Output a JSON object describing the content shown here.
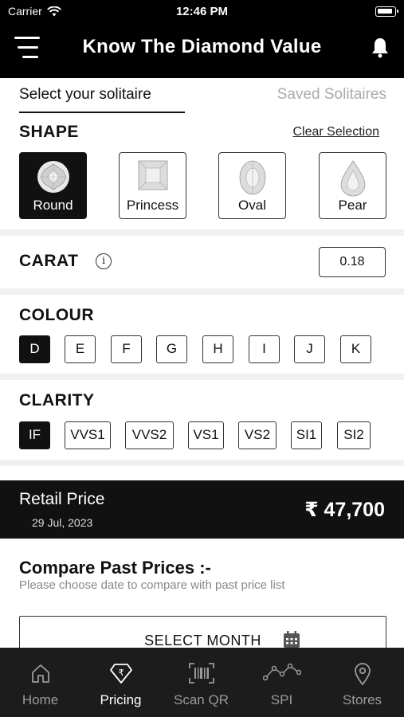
{
  "status_bar": {
    "carrier": "Carrier",
    "time": "12:46 PM"
  },
  "header": {
    "title": "Know The Diamond Value"
  },
  "tabs": [
    {
      "label": "Select your solitaire",
      "active": true
    },
    {
      "label": "Saved Solitaires",
      "active": false
    }
  ],
  "shape": {
    "title": "SHAPE",
    "clear_label": "Clear Selection",
    "options": [
      {
        "label": "Round",
        "selected": true
      },
      {
        "label": "Princess",
        "selected": false
      },
      {
        "label": "Oval",
        "selected": false
      },
      {
        "label": "Pear",
        "selected": false
      }
    ]
  },
  "carat": {
    "title": "CARAT",
    "info_glyph": "i",
    "value": "0.18"
  },
  "colour": {
    "title": "COLOUR",
    "options": [
      "D",
      "E",
      "F",
      "G",
      "H",
      "I",
      "J",
      "K"
    ],
    "selected": "D"
  },
  "clarity": {
    "title": "CLARITY",
    "options": [
      "IF",
      "VVS1",
      "VVS2",
      "VS1",
      "VS2",
      "SI1",
      "SI2"
    ],
    "selected": "IF"
  },
  "retail": {
    "label": "Retail Price",
    "date": "29 Jul, 2023",
    "price": "₹ 47,700"
  },
  "compare": {
    "title": "Compare Past Prices :-",
    "subtitle": "Please choose date to compare with past price list",
    "button_label": "SELECT MONTH"
  },
  "bottom_nav": [
    {
      "label": "Home",
      "icon": "home-icon",
      "active": false
    },
    {
      "label": "Pricing",
      "icon": "diamond-rupee-icon",
      "active": true
    },
    {
      "label": "Scan QR",
      "icon": "barcode-scan-icon",
      "active": false
    },
    {
      "label": "SPI",
      "icon": "line-graph-icon",
      "active": false
    },
    {
      "label": "Stores",
      "icon": "location-pin-icon",
      "active": false
    }
  ],
  "colors": {
    "primary": "#111111",
    "nav_background": "#1c1c1c",
    "muted_text": "#888888"
  }
}
